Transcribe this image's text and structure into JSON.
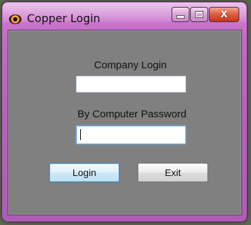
{
  "window": {
    "title": "Copper Login",
    "icon": "copper-eye-icon",
    "controls": {
      "minimize_icon": "minimize-icon",
      "maximize_icon": "maximize-icon",
      "close_glyph": "X"
    }
  },
  "form": {
    "company_login_label": "Company Login",
    "company_login_value": "",
    "password_label": "By Computer Password",
    "password_value": "",
    "login_button": "Login",
    "exit_button": "Exit"
  },
  "colors": {
    "client_background": "#808080",
    "title_bar": "#c16bc6",
    "close_button": "#dd5b3b"
  }
}
